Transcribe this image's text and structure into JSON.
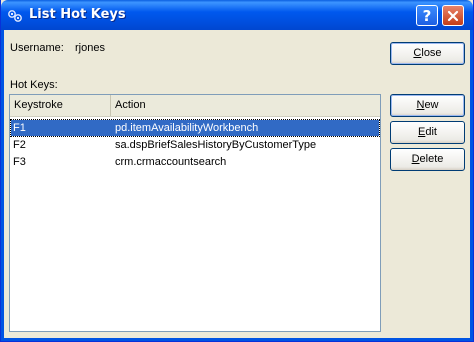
{
  "window": {
    "title": "List Hot Keys"
  },
  "user": {
    "label": "Username:",
    "value": "rjones"
  },
  "hotkeys": {
    "section_label": "Hot Keys:",
    "columns": [
      "Keystroke",
      "Action"
    ],
    "rows": [
      {
        "keystroke": "F1",
        "action": "pd.itemAvailabilityWorkbench",
        "selected": true
      },
      {
        "keystroke": "F2",
        "action": "sa.dspBriefSalesHistoryByCustomerType",
        "selected": false
      },
      {
        "keystroke": "F3",
        "action": "crm.crmaccountsearch",
        "selected": false
      }
    ]
  },
  "buttons": {
    "close": {
      "mnemonic": "C",
      "rest": "lose"
    },
    "new": {
      "mnemonic": "N",
      "rest": "ew"
    },
    "edit": {
      "mnemonic": "E",
      "rest": "dit"
    },
    "delete": {
      "mnemonic": "D",
      "rest": "elete"
    }
  },
  "colors": {
    "titlebar": "#0054e3",
    "selection": "#316ac5",
    "close_button": "#c43d18"
  },
  "icons": {
    "title": "hotkeys-app-icon",
    "help": "help-icon",
    "close": "close-x-icon"
  }
}
